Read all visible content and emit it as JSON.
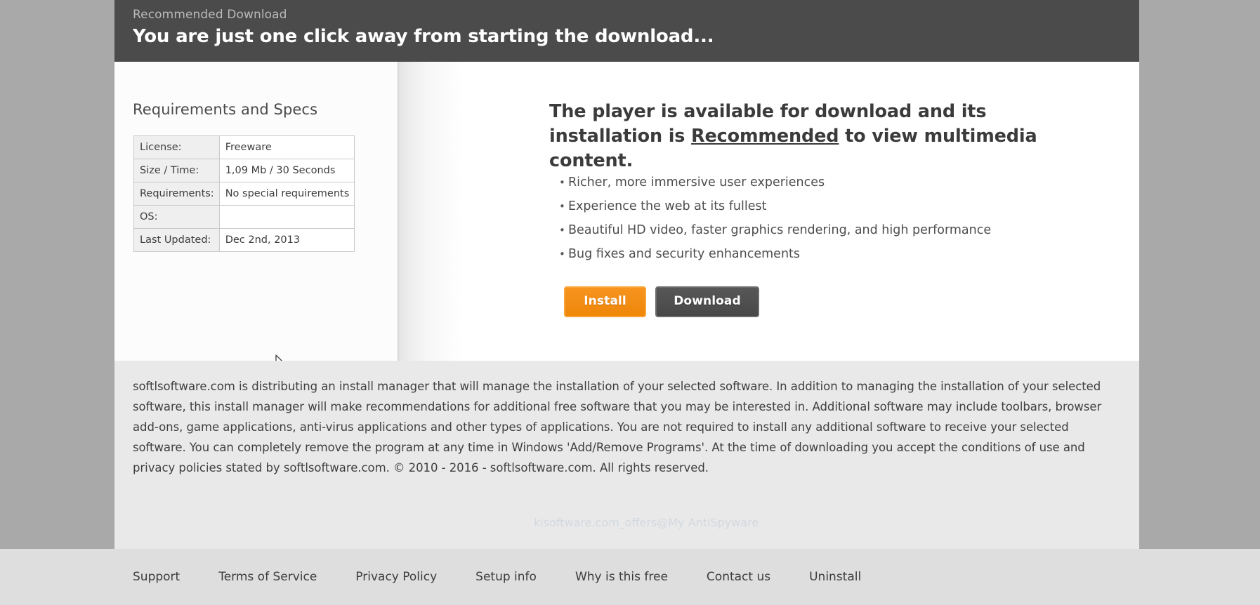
{
  "header": {
    "eyebrow": "Recommended Download",
    "title": "You are just one click away from starting the download..."
  },
  "left_panel": {
    "title": "Requirements and Specs",
    "specs_rows": [
      {
        "key": "License:",
        "value": "Freeware"
      },
      {
        "key": "Size / Time:",
        "value": "1,09 Mb / 30 Seconds"
      },
      {
        "key": "Requirements:",
        "value": "No special requirements"
      },
      {
        "key": "OS:",
        "value": ""
      },
      {
        "key": "Last Updated:",
        "value": "Dec 2nd, 2013"
      }
    ]
  },
  "right_panel": {
    "headline_part1": "The player is available for download and its installation is ",
    "headline_underlined": "Recommended",
    "headline_part2": " to view multimedia content.",
    "bullets": [
      "Richer, more immersive user experiences",
      "Experience the web at its fullest",
      "Beautiful HD video, faster graphics rendering, and high performance",
      "Bug fixes and security enhancements"
    ],
    "install_label": "Install",
    "download_label": "Download",
    "install_color": "#f28d15",
    "download_color": "#4f4f4f"
  },
  "disclaimer": {
    "text": "softlsoftware.com is distributing an install manager that will manage the installation of your selected software. In addition to managing the installation of your selected software, this install manager will make recommendations for additional free software that you may be interested in. Additional software may include toolbars, browser add-ons, game applications, anti-virus applications and other types of applications. You are not required to install any additional software to receive your selected software. You can completely remove the program at any time in Windows 'Add/Remove Programs'. At the time of downloading you accept the conditions of use and privacy policies stated by softlsoftware.com. © 2010 - 2016 - softlsoftware.com. All rights reserved."
  },
  "footer": {
    "links": [
      "Support",
      "Terms of Service",
      "Privacy Policy",
      "Setup info",
      "Why is this free",
      "Contact us",
      "Uninstall"
    ],
    "ghost_text": "kisoftware.com_offers@My AntiSpyware"
  }
}
